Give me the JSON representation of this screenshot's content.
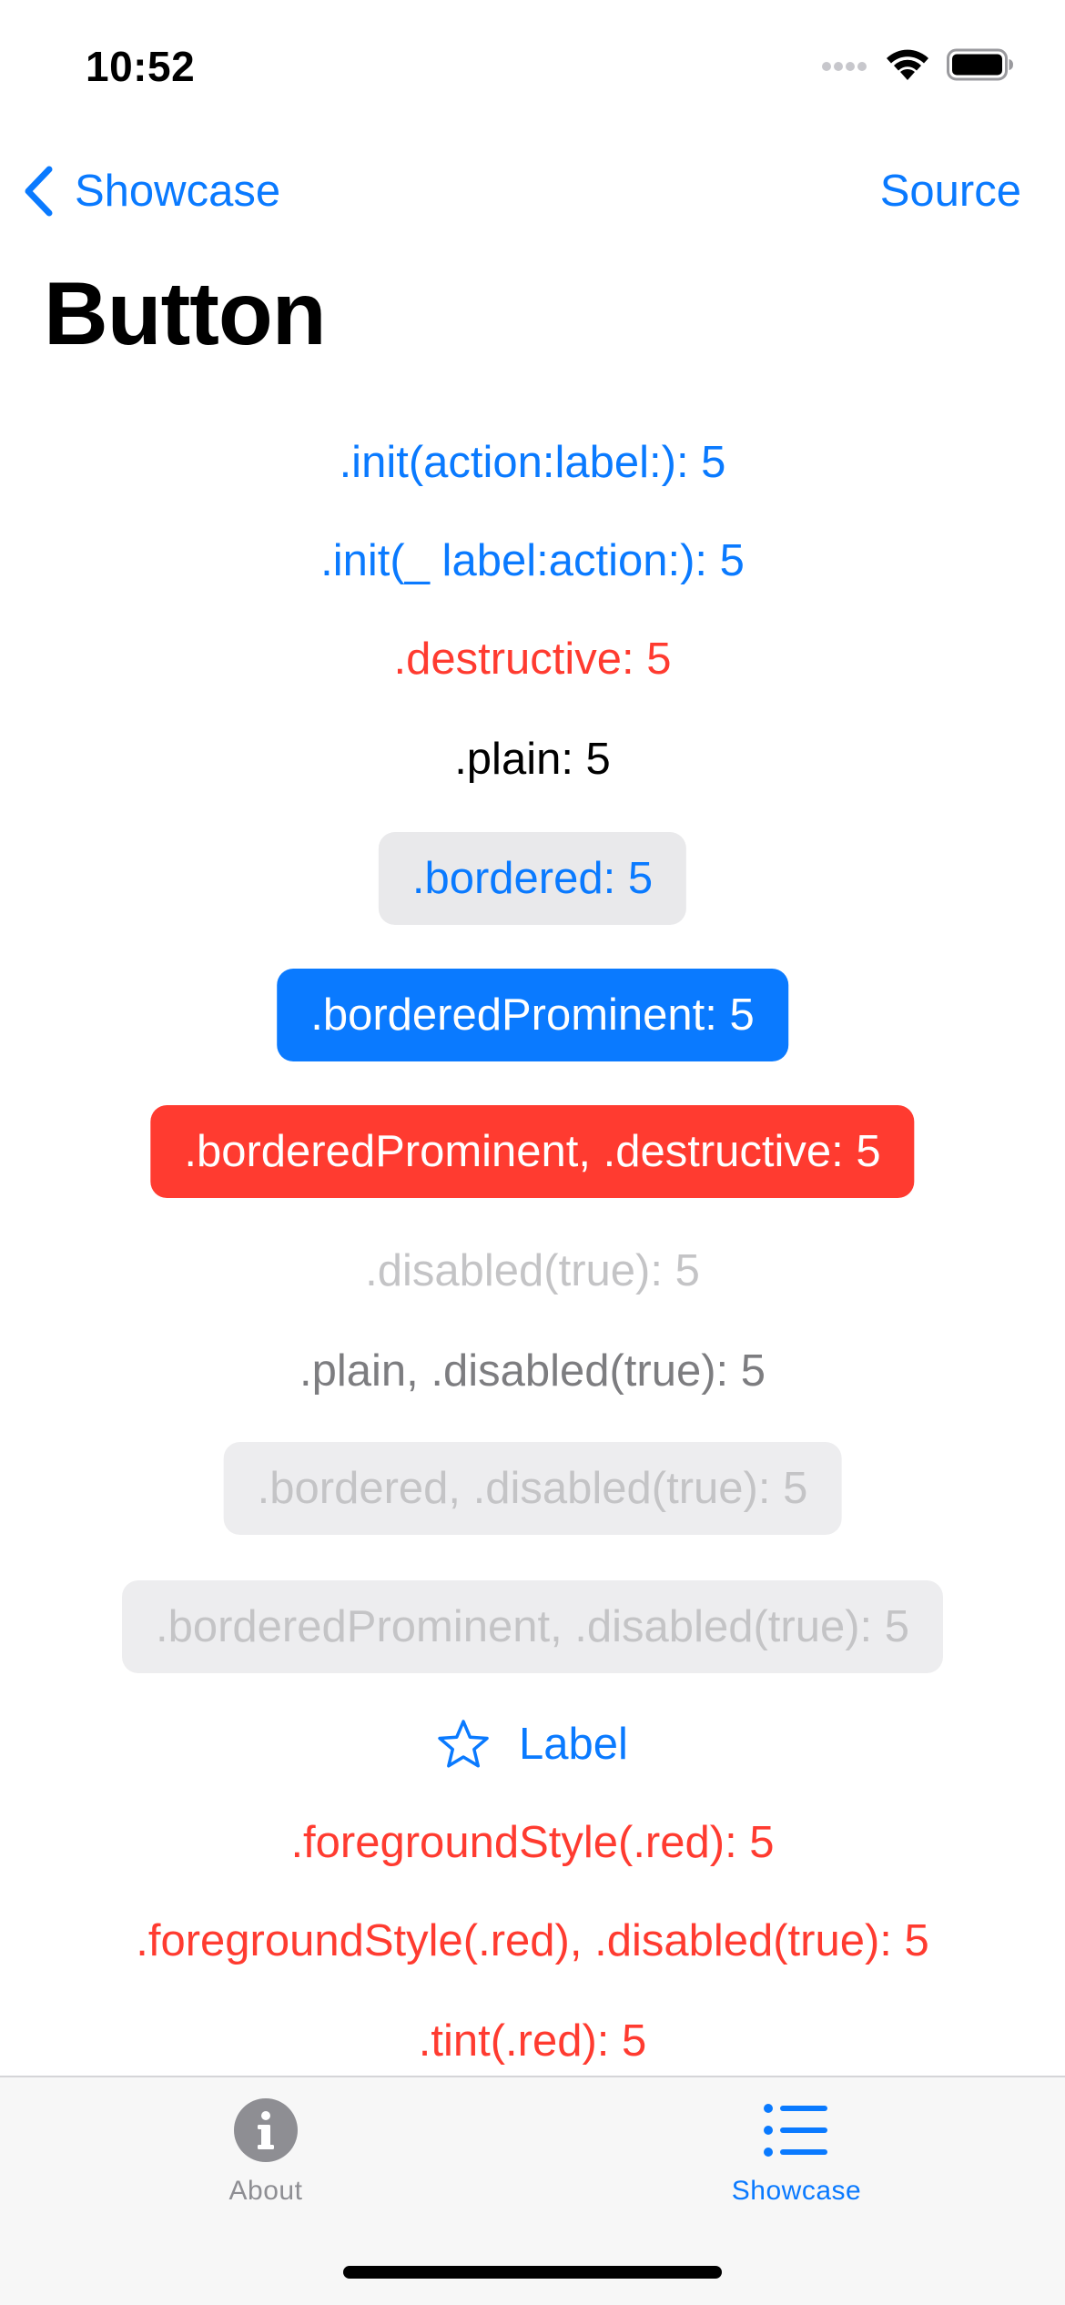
{
  "status_bar": {
    "time": "10:52"
  },
  "nav": {
    "back_label": "Showcase",
    "source_label": "Source"
  },
  "page": {
    "title": "Button"
  },
  "buttons": {
    "init_action_label": ".init(action:label:): 5",
    "init_label_action": ".init(_ label:action:): 5",
    "destructive": ".destructive: 5",
    "plain": ".plain: 5",
    "bordered": ".bordered: 5",
    "bordered_prominent": ".borderedProminent: 5",
    "bordered_prominent_destructive": ".borderedProminent, .destructive: 5",
    "disabled": ".disabled(true): 5",
    "plain_disabled": ".plain, .disabled(true): 5",
    "bordered_disabled": ".bordered, .disabled(true): 5",
    "bordered_prominent_disabled": ".borderedProminent, .disabled(true): 5",
    "label": "Label",
    "foreground_red": ".foregroundStyle(.red): 5",
    "foreground_red_disabled": ".foregroundStyle(.red), .disabled(true): 5",
    "tint_red": ".tint(.red): 5"
  },
  "tabs": [
    {
      "label": "About",
      "icon": "info-circle-icon",
      "selected": false
    },
    {
      "label": "Showcase",
      "icon": "list-icon",
      "selected": true
    }
  ],
  "colors": {
    "accent": "#0a7aff",
    "destructive": "#ff3b30",
    "bordered_fill": "#e9e9eb",
    "disabled_text": "#c4c4c6",
    "tab_inactive": "#8e8e93"
  }
}
